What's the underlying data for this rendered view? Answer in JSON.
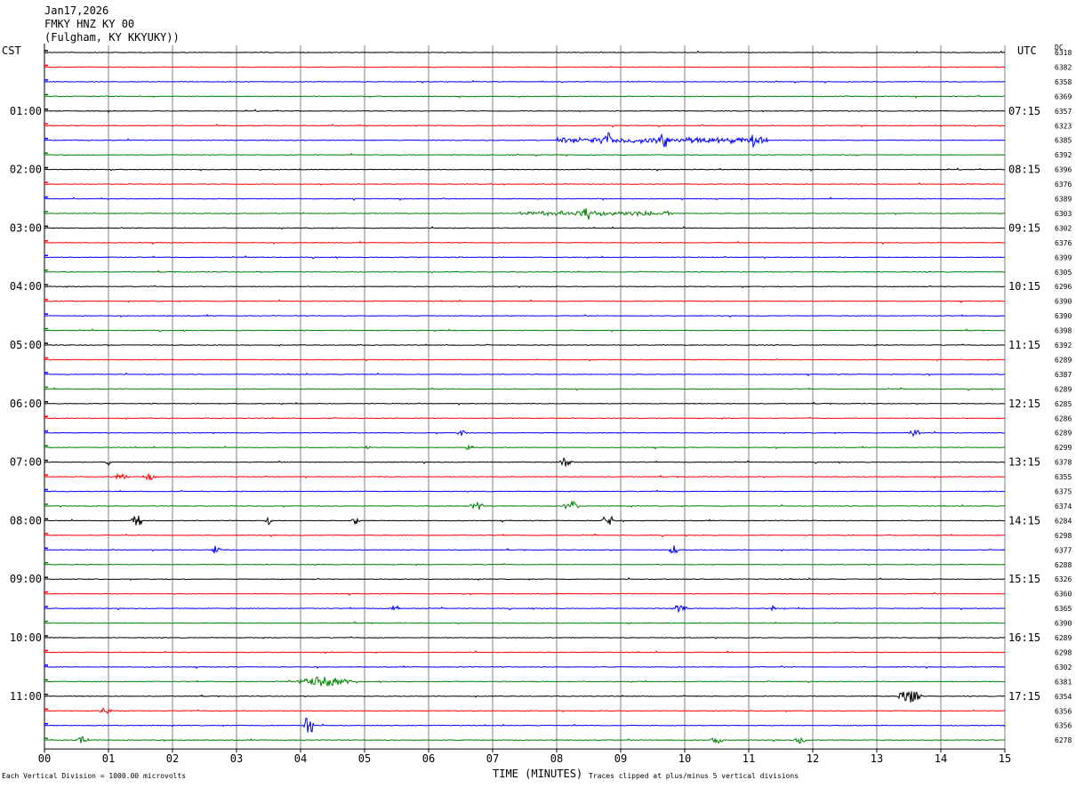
{
  "header": {
    "date": "Jan17,2026",
    "station": "FMKY HNZ KY 00",
    "location": "(Fulgham, KY KKYUKY))"
  },
  "left_tz_label": "CST",
  "right_tz_label": "UTC",
  "dc_label": "DC",
  "footer": {
    "scale_note": "Each Vertical Division = 1000.00 microvolts",
    "xaxis_title": "TIME (MINUTES)",
    "clip_note": "Traces clipped at plus/minus 5 vertical divisions"
  },
  "chart_data": {
    "type": "line",
    "title": "FMKY HNZ KY 00",
    "xlabel": "TIME (MINUTES)",
    "xlim": [
      0,
      15
    ],
    "x_ticks": [
      "00",
      "01",
      "02",
      "03",
      "04",
      "05",
      "06",
      "07",
      "08",
      "09",
      "10",
      "11",
      "12",
      "13",
      "14",
      "15"
    ],
    "trace_colors": [
      "#000000",
      "#ff0000",
      "#0000ff",
      "#008000"
    ],
    "trace_minutes": 15,
    "left_hour_labels": [
      "01:00",
      "02:00",
      "03:00",
      "04:00",
      "05:00",
      "06:00",
      "07:00",
      "08:00",
      "09:00",
      "10:00",
      "11:00"
    ],
    "right_hour_labels": [
      "07:15",
      "08:15",
      "09:15",
      "10:15",
      "11:15",
      "12:15",
      "13:15",
      "14:15",
      "15:15",
      "16:15",
      "17:15"
    ],
    "dc_offsets": [
      "6318",
      "6382",
      "6358",
      "6369",
      "6357",
      "6323",
      "6385",
      "6392",
      "6396",
      "6376",
      "6389",
      "6303",
      "6302",
      "6376",
      "6399",
      "6305",
      "6296",
      "6390",
      "6390",
      "6398",
      "6392",
      "6289",
      "6387",
      "6289",
      "6285",
      "6286",
      "6289",
      "6299",
      "6378",
      "6355",
      "6375",
      "6374",
      "6284",
      "6298",
      "6377",
      "6288",
      "6326",
      "6360",
      "6365",
      "6390",
      "6289",
      "6298",
      "6302",
      "6381",
      "6354",
      "6356",
      "6356",
      "6278"
    ],
    "events": [
      {
        "trace": 6,
        "t": 8.0,
        "dur": 3.3,
        "amp": 4
      },
      {
        "trace": 6,
        "t": 8.75,
        "dur": 0.1,
        "amp": 8
      },
      {
        "trace": 6,
        "t": 9.6,
        "dur": 0.15,
        "amp": 8
      },
      {
        "trace": 6,
        "t": 11.0,
        "dur": 0.1,
        "amp": 7
      },
      {
        "trace": 11,
        "t": 7.4,
        "dur": 2.4,
        "amp": 3
      },
      {
        "trace": 11,
        "t": 8.4,
        "dur": 0.15,
        "amp": 6
      },
      {
        "trace": 26,
        "t": 6.45,
        "dur": 0.15,
        "amp": 3
      },
      {
        "trace": 26,
        "t": 13.5,
        "dur": 0.2,
        "amp": 3
      },
      {
        "trace": 27,
        "t": 5.0,
        "dur": 0.1,
        "amp": 2
      },
      {
        "trace": 27,
        "t": 6.55,
        "dur": 0.15,
        "amp": 3
      },
      {
        "trace": 28,
        "t": 0.95,
        "dur": 0.08,
        "amp": 3
      },
      {
        "trace": 28,
        "t": 8.05,
        "dur": 0.2,
        "amp": 4
      },
      {
        "trace": 29,
        "t": 1.1,
        "dur": 0.2,
        "amp": 3
      },
      {
        "trace": 29,
        "t": 1.55,
        "dur": 0.2,
        "amp": 3
      },
      {
        "trace": 31,
        "t": 6.65,
        "dur": 0.2,
        "amp": 4
      },
      {
        "trace": 31,
        "t": 8.1,
        "dur": 0.25,
        "amp": 4
      },
      {
        "trace": 32,
        "t": 1.35,
        "dur": 0.2,
        "amp": 5
      },
      {
        "trace": 32,
        "t": 3.45,
        "dur": 0.12,
        "amp": 4
      },
      {
        "trace": 32,
        "t": 4.8,
        "dur": 0.12,
        "amp": 3
      },
      {
        "trace": 32,
        "t": 8.7,
        "dur": 0.2,
        "amp": 5
      },
      {
        "trace": 34,
        "t": 2.6,
        "dur": 0.15,
        "amp": 4
      },
      {
        "trace": 34,
        "t": 9.75,
        "dur": 0.15,
        "amp": 4
      },
      {
        "trace": 38,
        "t": 5.4,
        "dur": 0.15,
        "amp": 3
      },
      {
        "trace": 38,
        "t": 9.8,
        "dur": 0.25,
        "amp": 3
      },
      {
        "trace": 38,
        "t": 11.35,
        "dur": 0.08,
        "amp": 3
      },
      {
        "trace": 43,
        "t": 3.9,
        "dur": 0.9,
        "amp": 4
      },
      {
        "trace": 44,
        "t": 13.3,
        "dur": 0.4,
        "amp": 6
      },
      {
        "trace": 45,
        "t": 0.85,
        "dur": 0.2,
        "amp": 3
      },
      {
        "trace": 46,
        "t": 4.05,
        "dur": 0.15,
        "amp": 11
      },
      {
        "trace": 47,
        "t": 0.5,
        "dur": 0.2,
        "amp": 3
      },
      {
        "trace": 47,
        "t": 10.4,
        "dur": 0.2,
        "amp": 3
      },
      {
        "trace": 47,
        "t": 11.7,
        "dur": 0.2,
        "amp": 3
      }
    ]
  }
}
